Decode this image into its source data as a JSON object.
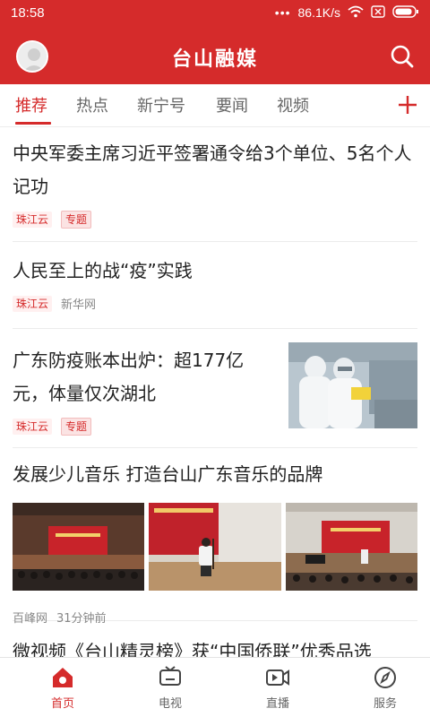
{
  "status_bar": {
    "time": "18:58",
    "dots": "•••",
    "network_speed": "86.1K/s"
  },
  "header": {
    "app_title": "台山融媒"
  },
  "tabs": [
    {
      "label": "推荐",
      "active": true
    },
    {
      "label": "热点",
      "active": false
    },
    {
      "label": "新宁号",
      "active": false
    },
    {
      "label": "要闻",
      "active": false
    },
    {
      "label": "视频",
      "active": false
    }
  ],
  "add_tab_label": "+",
  "feed": [
    {
      "title": "中央军委主席习近平签署通令给3个单位、5名个人记功",
      "tags": [
        "珠江云",
        "专题"
      ],
      "source": ""
    },
    {
      "title": "人民至上的战“疫”实践",
      "tags": [
        "珠江云"
      ],
      "source": "新华网"
    },
    {
      "title": "广东防疫账本出炉：超177亿元，体量仅次湖北",
      "tags": [
        "珠江云",
        "专题"
      ],
      "source": ""
    },
    {
      "title": "发展少儿音乐 打造台山广东音乐的品牌",
      "tags": [],
      "source": "百峰网",
      "time_ago": "31分钟前"
    },
    {
      "title": "微视频《台山精灵榜》获“中国侨联”优秀品选",
      "tags": [],
      "source": ""
    }
  ],
  "bottom_nav": [
    {
      "label": "首页",
      "icon": "home-icon",
      "active": true
    },
    {
      "label": "电视",
      "icon": "tv-icon",
      "active": false
    },
    {
      "label": "直播",
      "icon": "live-icon",
      "active": false
    },
    {
      "label": "服务",
      "icon": "compass-icon",
      "active": false
    }
  ],
  "colors": {
    "brand_red": "#d52b2b"
  }
}
